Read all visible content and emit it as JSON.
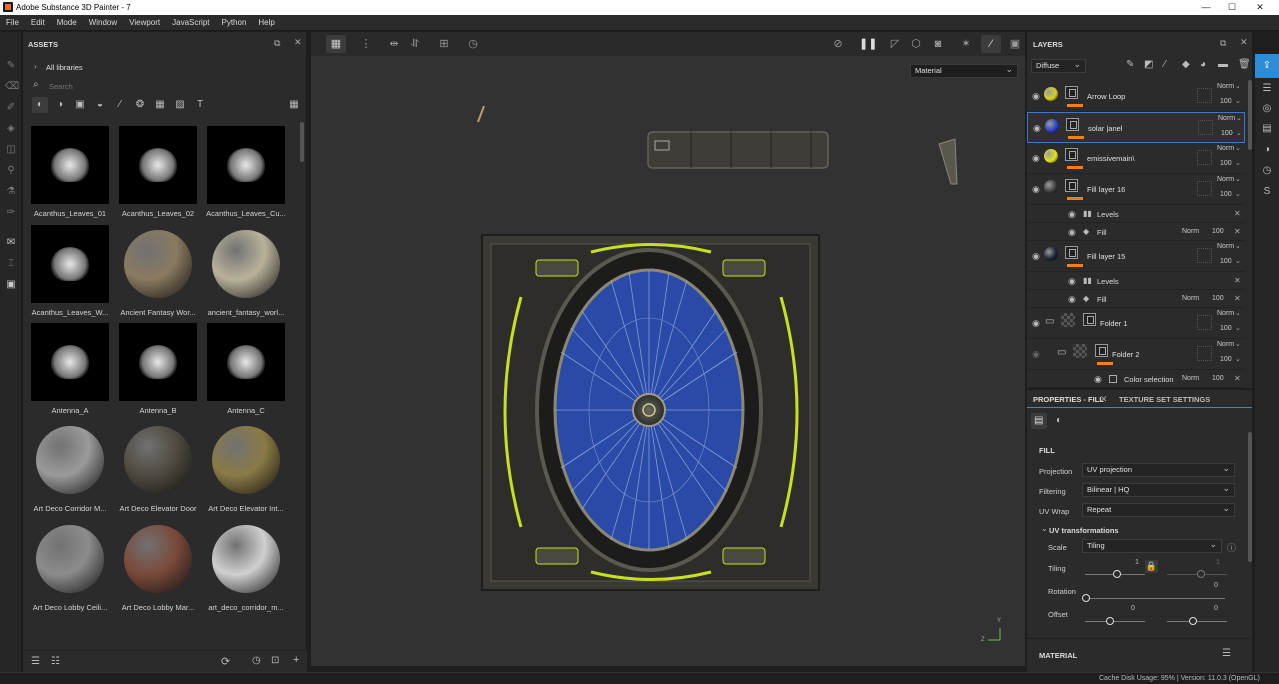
{
  "window": {
    "title": "Adobe Substance 3D Painter - 7",
    "minimize": "—",
    "maximize": "☐",
    "close": "✕"
  },
  "menu": [
    "File",
    "Edit",
    "Mode",
    "Window",
    "Viewport",
    "JavaScript",
    "Python",
    "Help"
  ],
  "assets": {
    "panel_title": "ASSETS",
    "library": "All libraries",
    "search_placeholder": "Search",
    "items": [
      {
        "label": "Acanthus_Leaves_01",
        "kind": "alpha"
      },
      {
        "label": "Acanthus_Leaves_02",
        "kind": "alpha"
      },
      {
        "label": "Acanthus_Leaves_Cu...",
        "kind": "alpha"
      },
      {
        "label": "Acanthus_Leaves_W...",
        "kind": "alpha"
      },
      {
        "label": "Ancient Fantasy Wor...",
        "kind": "sphere",
        "color": "#8a7a60"
      },
      {
        "label": "ancient_fantasy_worl...",
        "kind": "sphere",
        "color": "#b9b29a"
      },
      {
        "label": "Antenna_A",
        "kind": "alpha"
      },
      {
        "label": "Antenna_B",
        "kind": "alpha"
      },
      {
        "label": "Antenna_C",
        "kind": "alpha"
      },
      {
        "label": "Art Deco Corridor M...",
        "kind": "sphere",
        "color": "#9a9a9a"
      },
      {
        "label": "Art Deco Elevator Door",
        "kind": "sphere",
        "color": "#4f4a40"
      },
      {
        "label": "Art Deco Elevator Int...",
        "kind": "sphere",
        "color": "#8a7a45"
      },
      {
        "label": "Art Deco Lobby Ceili...",
        "kind": "sphere",
        "color": "#8c8c8c"
      },
      {
        "label": "Art Deco Lobby Mar...",
        "kind": "sphere",
        "color": "#7a4a3a"
      },
      {
        "label": "art_deco_corridor_m...",
        "kind": "sphere",
        "color": "#d0d0d0"
      }
    ]
  },
  "viewport": {
    "mode_select": "Material"
  },
  "layers": {
    "panel_title": "LAYERS",
    "channel": "Diffuse",
    "rows": [
      {
        "name": "Arrow Loop",
        "blend": "Norm",
        "opacity": "100",
        "color": "#d6d21c",
        "type": "layer"
      },
      {
        "name": "solar |anel",
        "blend": "Norm",
        "opacity": "100",
        "color": "#2a3ec8",
        "type": "layer"
      },
      {
        "name": "emissivemain\\",
        "blend": "Norm",
        "opacity": "100",
        "color": "#e2e21a",
        "type": "layer"
      },
      {
        "name": "Fill layer 16",
        "blend": "Norm",
        "opacity": "100",
        "color": "#3a3a3a",
        "type": "layer"
      },
      {
        "name": "Levels",
        "type": "effect"
      },
      {
        "name": "Fill",
        "blend": "Norm",
        "opacity": "100",
        "type": "effect"
      },
      {
        "name": "Fill layer 15",
        "blend": "Norm",
        "opacity": "100",
        "color": "#1c2238",
        "type": "layer"
      },
      {
        "name": "Levels",
        "type": "effect"
      },
      {
        "name": "Fill",
        "blend": "Norm",
        "opacity": "100",
        "type": "effect"
      },
      {
        "name": "Folder 1",
        "blend": "Norm",
        "opacity": "100",
        "type": "folder"
      },
      {
        "name": "Folder 2",
        "blend": "Norm",
        "opacity": "100",
        "type": "folder"
      },
      {
        "name": "Color selection",
        "blend": "Norm",
        "opacity": "100",
        "type": "effect"
      }
    ]
  },
  "properties": {
    "tab_fill": "PROPERTIES - FILL",
    "tab_texset": "TEXTURE SET SETTINGS",
    "section": "FILL",
    "projection_label": "Projection",
    "projection": "UV projection",
    "filtering_label": "Filtering",
    "filtering": "Bilinear | HQ",
    "uvwrap_label": "UV Wrap",
    "uvwrap": "Repeat",
    "uvtrans": "UV transformations",
    "scale_label": "Scale",
    "scale": "Tiling",
    "tiling_label": "Tiling",
    "tiling_value": "1",
    "tiling_value2": "1",
    "rotation_label": "Rotation",
    "rotation_value": "0",
    "offset_label": "Offset",
    "offset_u": "0",
    "offset_v": "0",
    "material_section": "MATERIAL"
  },
  "status": {
    "text": "Cache Disk Usage:   95% | Version: 11.0.3 (OpenGL)"
  },
  "colors": {
    "accent": "#2e8bd6",
    "orange": "#f0801e",
    "emissive": "#c8e020",
    "panel_blue": "#2a4aa8"
  }
}
